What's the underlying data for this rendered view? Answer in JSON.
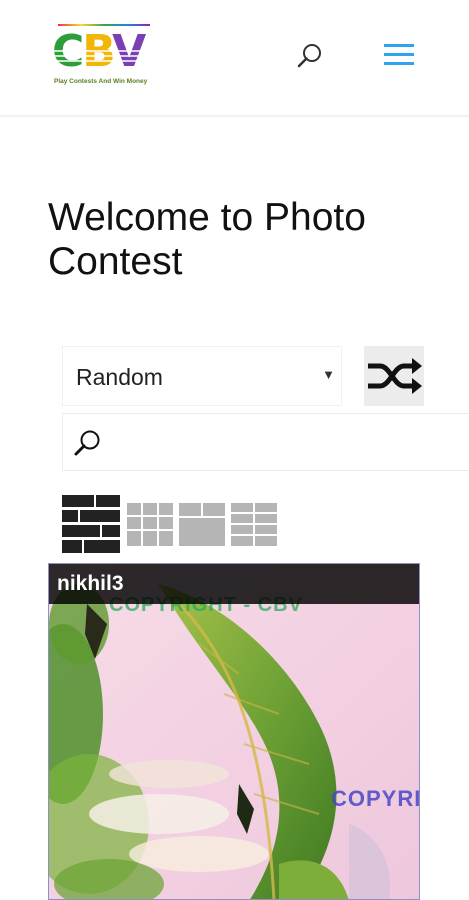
{
  "header": {
    "logo": {
      "letters": [
        "C",
        "B",
        "V"
      ],
      "tagline": "Play Contests And Win Money"
    },
    "icons": {
      "search": "search-icon",
      "menu": "hamburger-menu-icon"
    },
    "colors": {
      "menu_accent": "#2ea3f2"
    }
  },
  "main": {
    "title": "Welcome to Photo Contest",
    "sort": {
      "selected": "Random",
      "icon": "shuffle-icon"
    },
    "search": {
      "value": "",
      "placeholder": "",
      "icon": "search-icon"
    },
    "view_modes": [
      {
        "name": "brick-view",
        "active": true
      },
      {
        "name": "grid-view",
        "active": false
      },
      {
        "name": "mosaic-view",
        "active": false
      },
      {
        "name": "tile-view",
        "active": false
      }
    ],
    "photos": [
      {
        "author": "nikhil3",
        "watermarks": [
          "COPYRIGHT - CBV",
          "COPYRI"
        ]
      }
    ]
  }
}
